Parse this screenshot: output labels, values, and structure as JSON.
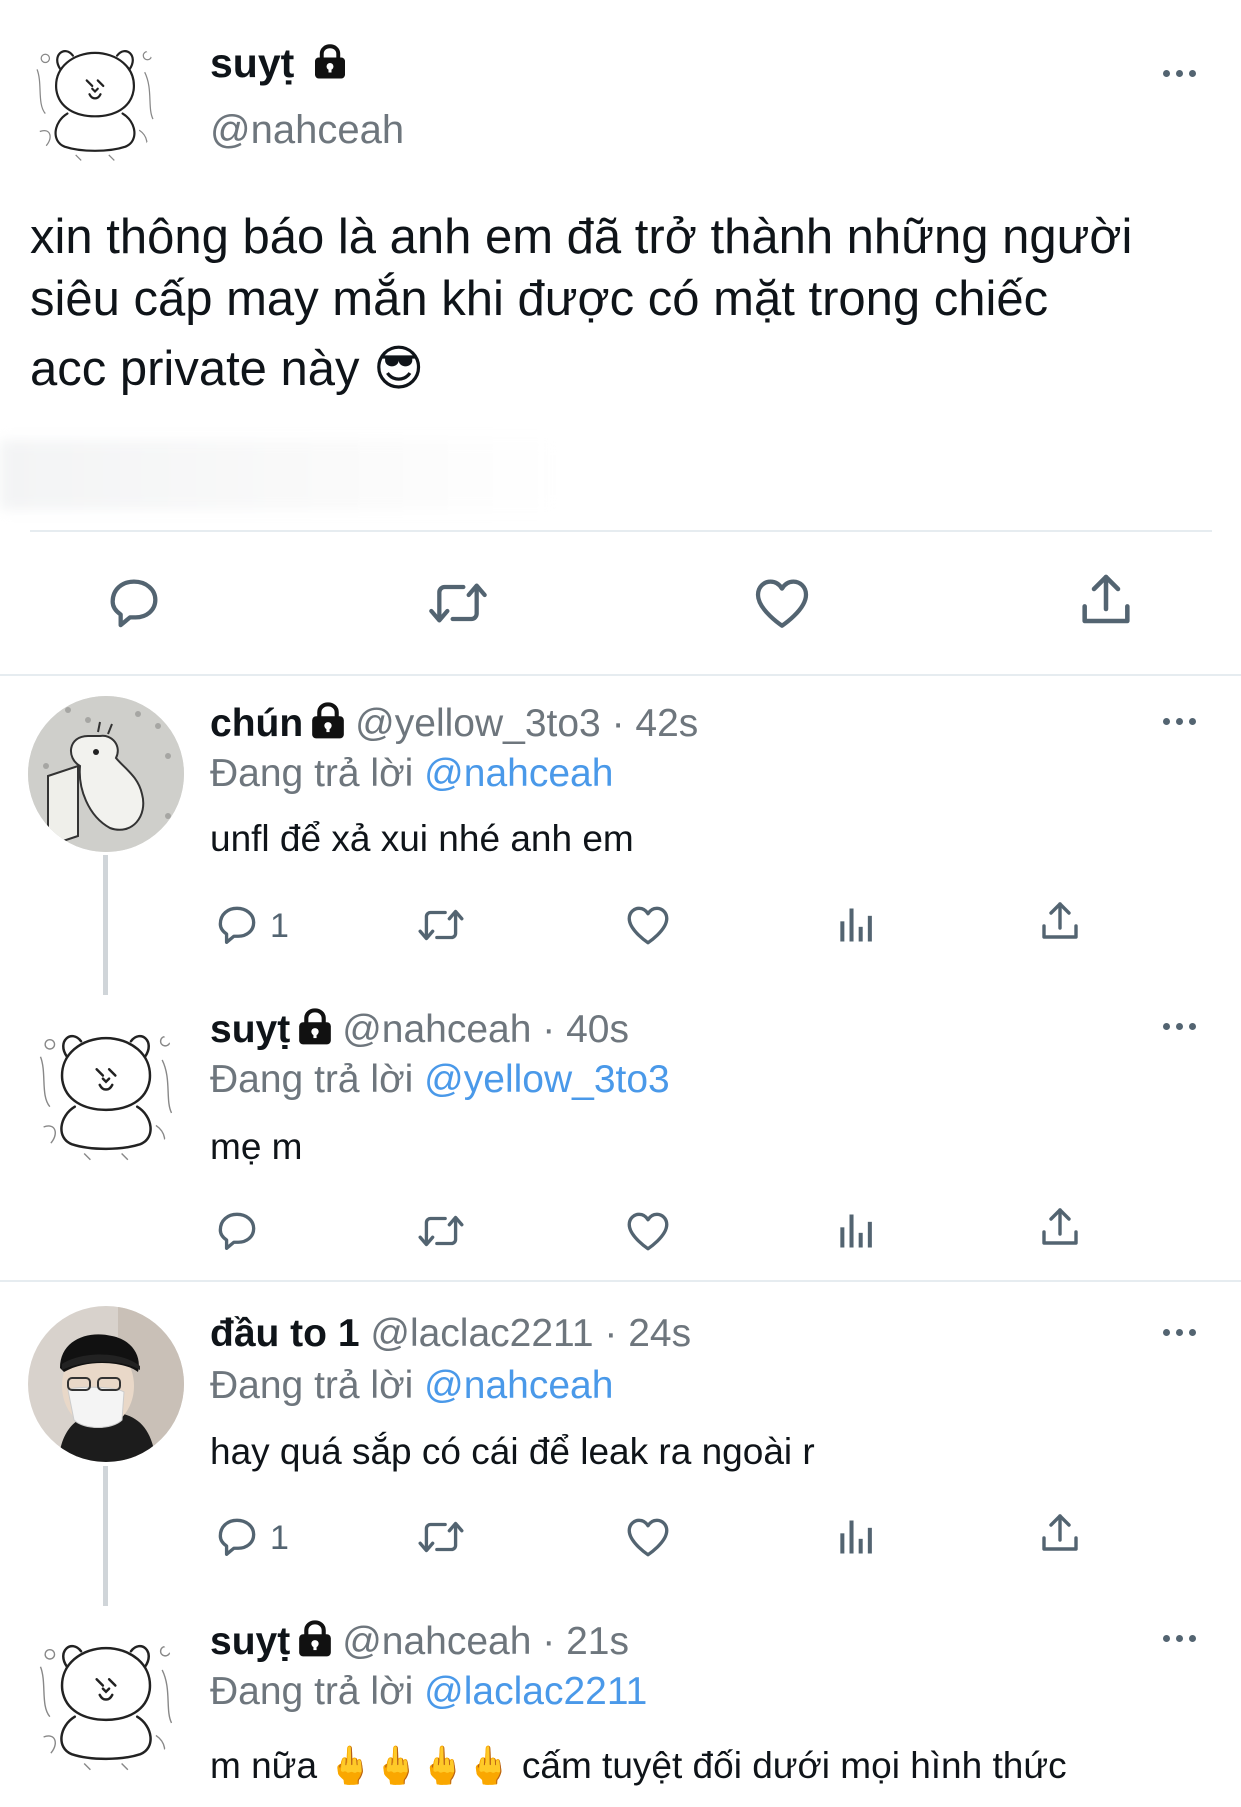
{
  "main_tweet": {
    "display_name": "suyṭ",
    "handle": "@nahceah",
    "text_line1": "xin thông báo là anh em đã trở thành những người",
    "text_line2": "siêu cấp may mắn khi được có mặt trong chiếc",
    "text_line3": "acc private này 😎"
  },
  "replies": [
    {
      "display_name": "chún",
      "handle": "@yellow_3to3",
      "time": "· 42s",
      "replying_prefix": "Đang trả lời",
      "replying_to": "@nahceah",
      "text": "unfl để xả xui nhé anh em",
      "reply_count": "1"
    },
    {
      "display_name": "suyṭ",
      "handle": "@nahceah",
      "time": "· 40s",
      "replying_prefix": "Đang trả lời",
      "replying_to": "@yellow_3to3",
      "text": "mẹ m",
      "reply_count": ""
    },
    {
      "display_name": "đầu to 1",
      "handle": "@laclac2211",
      "time": "· 24s",
      "replying_prefix": "Đang trả lời",
      "replying_to": "@nahceah",
      "text": "hay quá sắp có cái để leak ra ngoài r",
      "reply_count": "1"
    },
    {
      "display_name": "suyṭ",
      "handle": "@nahceah",
      "time": "· 21s",
      "replying_prefix": "Đang trả lời",
      "replying_to": "@laclac2211",
      "text": "m nữa 🖕🖕🖕🖕  cấm tuyệt đối dưới mọi hình thức",
      "reply_count": ""
    }
  ],
  "icons": {
    "lock": "lock-icon",
    "more": "more-icon",
    "reply": "reply-icon",
    "retweet": "retweet-icon",
    "like": "heart-icon",
    "analytics": "analytics-icon",
    "share": "share-icon"
  },
  "colors": {
    "link": "#4a99e9",
    "muted": "#6e767d",
    "icon": "#536471",
    "divider": "#e6ecf0"
  }
}
